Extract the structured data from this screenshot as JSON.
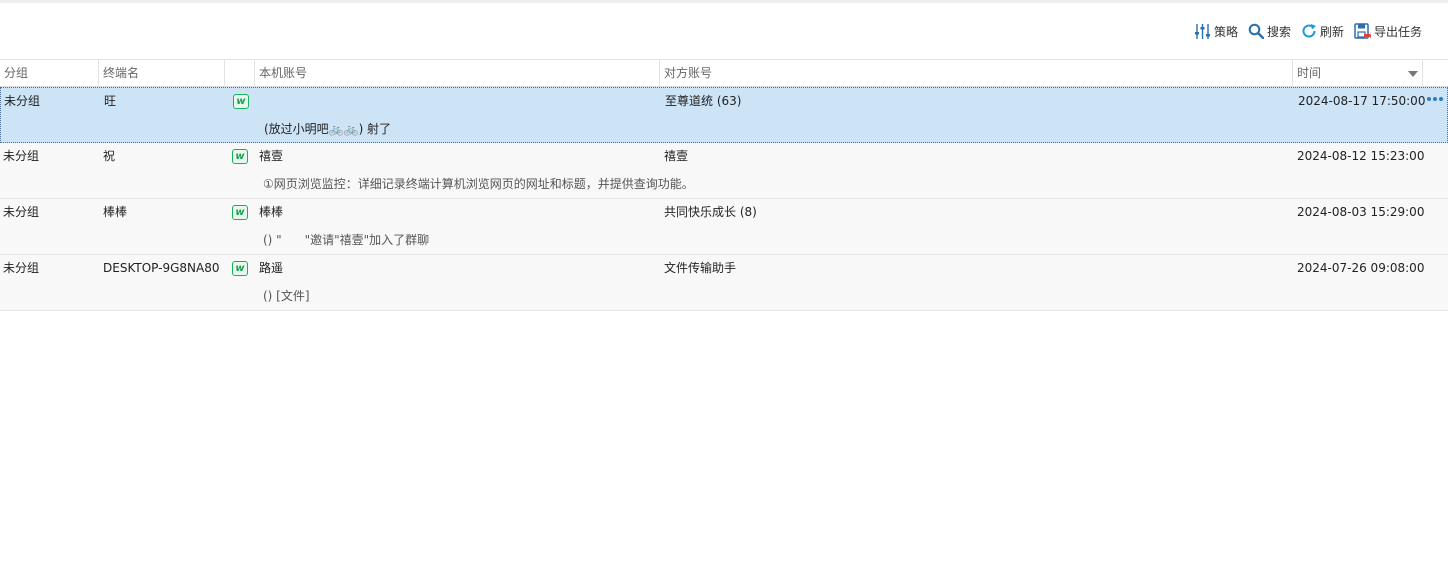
{
  "toolbar": {
    "strategy_label": "策略",
    "search_label": "搜索",
    "refresh_label": "刷新",
    "export_label": "导出任务"
  },
  "table": {
    "headers": {
      "group": "分组",
      "terminal": "终端名",
      "local_account": "本机账号",
      "peer_account": "对方账号",
      "time": "时间"
    },
    "rows": [
      {
        "group": "未分组",
        "terminal": "旺",
        "app_icon": "wechat-icon",
        "local_account": "",
        "peer_account": "至尊道统 (63)",
        "time": "2024-08-17 17:50:00",
        "message": "(放过小明吧🚲🚲) 射了",
        "selected": true
      },
      {
        "group": "未分组",
        "terminal": "祝",
        "app_icon": "wechat-icon",
        "local_account": "禧壹",
        "peer_account": "禧壹",
        "time": "2024-08-12 15:23:00",
        "message": "①网页浏览监控：详细记录终端计算机浏览网页的网址和标题，并提供查询功能。",
        "selected": false
      },
      {
        "group": "未分组",
        "terminal": "棒棒",
        "app_icon": "wechat-icon",
        "local_account": "棒棒",
        "peer_account": "共同快乐成长 (8)",
        "time": "2024-08-03 15:29:00",
        "message": "() \"      \"邀请\"禧壹\"加入了群聊",
        "selected": false
      },
      {
        "group": "未分组",
        "terminal": "DESKTOP-9G8NA80",
        "app_icon": "wechat-icon",
        "local_account": "路遥",
        "peer_account": "文件传输助手",
        "time": "2024-07-26 09:08:00",
        "message": "() [文件]",
        "selected": false
      }
    ]
  },
  "colors": {
    "selected_row": "#cde4f7",
    "accent": "#2a7ec8",
    "wechat_green": "#19b25a"
  }
}
